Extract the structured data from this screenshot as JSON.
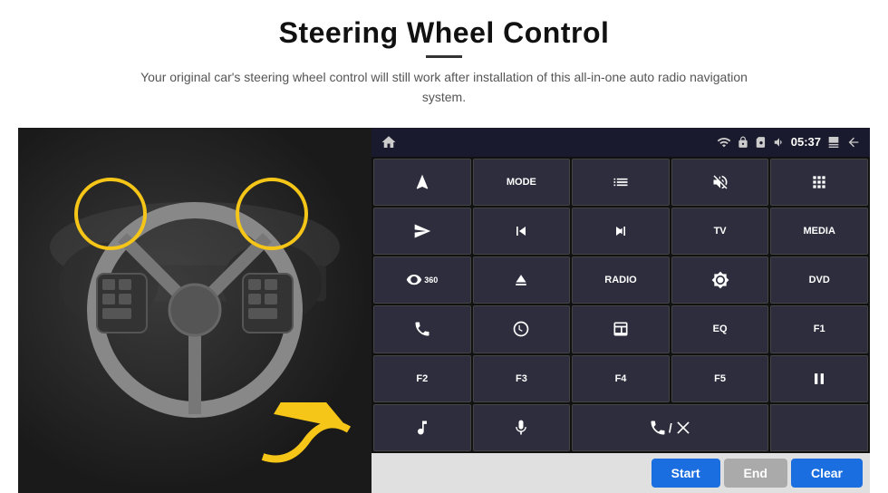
{
  "header": {
    "title": "Steering Wheel Control",
    "subtitle": "Your original car's steering wheel control will still work after installation of this all-in-one auto radio navigation system."
  },
  "status_bar": {
    "time": "05:37",
    "icons": [
      "wifi",
      "lock",
      "sim",
      "volume",
      "screen",
      "back"
    ]
  },
  "button_grid": [
    {
      "id": "nav",
      "type": "icon",
      "label": "nav"
    },
    {
      "id": "mode",
      "type": "text",
      "label": "MODE"
    },
    {
      "id": "list",
      "type": "icon",
      "label": "list"
    },
    {
      "id": "mute",
      "type": "icon",
      "label": "mute"
    },
    {
      "id": "apps",
      "type": "icon",
      "label": "apps"
    },
    {
      "id": "send",
      "type": "icon",
      "label": "send"
    },
    {
      "id": "prev",
      "type": "icon",
      "label": "prev"
    },
    {
      "id": "next",
      "type": "icon",
      "label": "next"
    },
    {
      "id": "tv",
      "type": "text",
      "label": "TV"
    },
    {
      "id": "media",
      "type": "text",
      "label": "MEDIA"
    },
    {
      "id": "camera360",
      "type": "icon",
      "label": "360"
    },
    {
      "id": "eject",
      "type": "icon",
      "label": "eject"
    },
    {
      "id": "radio",
      "type": "text",
      "label": "RADIO"
    },
    {
      "id": "brightness",
      "type": "icon",
      "label": "brightness"
    },
    {
      "id": "dvd",
      "type": "text",
      "label": "DVD"
    },
    {
      "id": "phone",
      "type": "icon",
      "label": "phone"
    },
    {
      "id": "nav2",
      "type": "icon",
      "label": "nav2"
    },
    {
      "id": "window",
      "type": "icon",
      "label": "window"
    },
    {
      "id": "eq",
      "type": "text",
      "label": "EQ"
    },
    {
      "id": "f1",
      "type": "text",
      "label": "F1"
    },
    {
      "id": "f2",
      "type": "text",
      "label": "F2"
    },
    {
      "id": "f3",
      "type": "text",
      "label": "F3"
    },
    {
      "id": "f4",
      "type": "text",
      "label": "F4"
    },
    {
      "id": "f5",
      "type": "text",
      "label": "F5"
    },
    {
      "id": "playpause",
      "type": "icon",
      "label": "play/pause"
    },
    {
      "id": "music",
      "type": "icon",
      "label": "music"
    },
    {
      "id": "mic",
      "type": "icon",
      "label": "mic"
    },
    {
      "id": "call",
      "type": "icon",
      "label": "call"
    }
  ],
  "action_bar": {
    "start_label": "Start",
    "end_label": "End",
    "clear_label": "Clear"
  }
}
